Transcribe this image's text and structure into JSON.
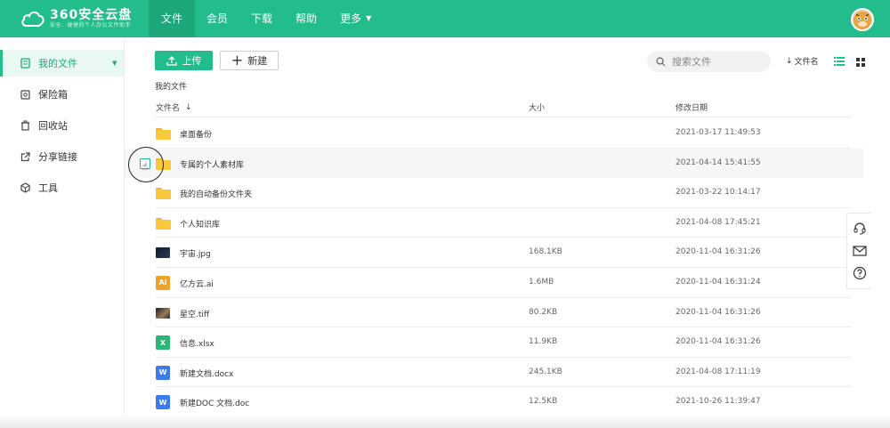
{
  "header": {
    "brand_name": "360安全云盘",
    "brand_slogan": "安全、便捷的个人办公文件助手",
    "nav": [
      {
        "label": "文件",
        "active": true
      },
      {
        "label": "会员",
        "active": false
      },
      {
        "label": "下载",
        "active": false
      },
      {
        "label": "帮助",
        "active": false
      },
      {
        "label": "更多",
        "active": false,
        "has_caret": true
      }
    ],
    "brand_color": "#23bc8c"
  },
  "sidebar": {
    "items": [
      {
        "label": "我的文件",
        "icon": "document-icon",
        "active": true
      },
      {
        "label": "保险箱",
        "icon": "safe-icon",
        "active": false
      },
      {
        "label": "回收站",
        "icon": "trash-icon",
        "active": false
      },
      {
        "label": "分享链接",
        "icon": "share-icon",
        "active": false
      },
      {
        "label": "工具",
        "icon": "box-icon",
        "active": false
      }
    ]
  },
  "toolbar": {
    "upload_label": "上传",
    "new_label": "新建",
    "search_placeholder": "搜索文件",
    "sort_label": "文件名"
  },
  "breadcrumb": "我的文件",
  "table": {
    "columns": {
      "name": "文件名",
      "size": "大小",
      "date": "修改日期"
    },
    "rows": [
      {
        "name": "桌面备份",
        "type": "folder",
        "size": "",
        "date": "2021-03-17 11:49:53"
      },
      {
        "name": "专属的个人素材库",
        "type": "folder",
        "size": "",
        "date": "2021-04-14 15:41:55"
      },
      {
        "name": "我的自动备份文件夹",
        "type": "folder",
        "size": "",
        "date": "2021-03-22 10:14:17"
      },
      {
        "name": "个人知识库",
        "type": "folder",
        "size": "",
        "date": "2021-04-08 17:45:21"
      },
      {
        "name": "宇宙.jpg",
        "type": "image",
        "size": "168.1KB",
        "date": "2020-11-04 16:31:26"
      },
      {
        "name": "亿方云.ai",
        "type": "ai",
        "size": "1.6MB",
        "date": "2020-11-04 16:31:24"
      },
      {
        "name": "星空.tiff",
        "type": "image2",
        "size": "80.2KB",
        "date": "2020-11-04 16:31:26"
      },
      {
        "name": "信息.xlsx",
        "type": "xlsx",
        "size": "11.9KB",
        "date": "2020-11-04 16:31:26"
      },
      {
        "name": "新建文档.docx",
        "type": "docx",
        "size": "245.1KB",
        "date": "2021-04-08 17:11:19"
      },
      {
        "name": "新建DOC 文档.doc",
        "type": "doc",
        "size": "12.5KB",
        "date": "2021-10-26 11:39:47"
      }
    ]
  },
  "file_icon_labels": {
    "ai": "Ai",
    "xlsx": "X",
    "docx": "W",
    "doc": "W"
  }
}
